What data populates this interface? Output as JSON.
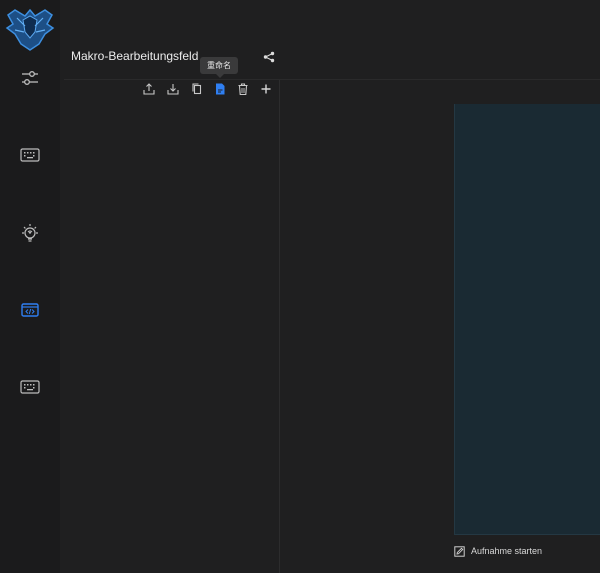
{
  "sidebar": {
    "items": [
      {
        "name": "sliders-icon"
      },
      {
        "name": "keyboard-icon"
      },
      {
        "name": "lightbulb-icon"
      },
      {
        "name": "macro-icon",
        "active": true
      },
      {
        "name": "keyboard-alt-icon"
      }
    ],
    "active_color": "#2f7ff2"
  },
  "header": {
    "title": "Makro-Bearbeitungsfeld"
  },
  "toolbar": {
    "tooltip": "重命名",
    "icons": [
      "export-icon",
      "import-icon",
      "copy-icon",
      "rename-icon",
      "delete-icon",
      "add-icon"
    ]
  },
  "editor": {
    "record_label": "Aufnahme starten"
  },
  "colors": {
    "background": "#1f1f20",
    "accent": "#2f7ff2",
    "panel": "#1a2a33"
  }
}
